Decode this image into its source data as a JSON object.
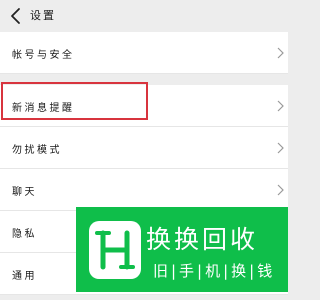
{
  "header": {
    "title": "设置"
  },
  "settings": [
    {
      "label": "帐号与安全"
    },
    {
      "label": "新消息提醒"
    },
    {
      "label": "勿扰模式"
    },
    {
      "label": "聊天"
    },
    {
      "label": "隐私"
    },
    {
      "label": "通用"
    }
  ],
  "watermark": {
    "title": "换换回收",
    "subtitle": "旧|手|机|换|钱"
  },
  "colors": {
    "highlight": "#d8343e",
    "watermark_green": "#0fbe4a",
    "background": "#ededed"
  }
}
